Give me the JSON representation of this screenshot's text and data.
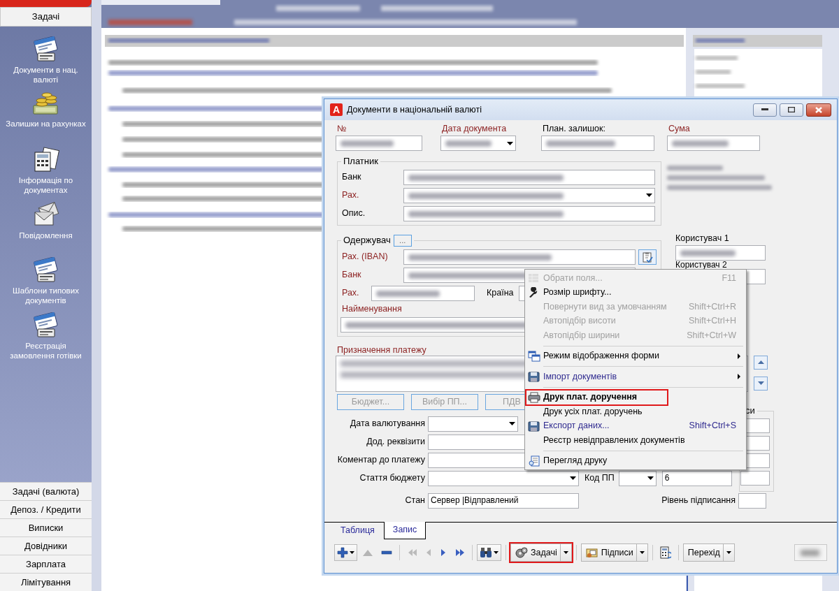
{
  "sidebar": {
    "header": "Задачі",
    "items": [
      "Документи в нац. валюті",
      "Залишки на рахунках",
      "Інформація по документах",
      "Повідомлення",
      "Шаблони типових документів",
      "Реєстрація замовлення готівки"
    ],
    "sections": [
      "Задачі (валюта)",
      "Депоз. / Кредити",
      "Виписки",
      "Довідники",
      "Зарплата",
      "Лімітування"
    ]
  },
  "dialog": {
    "app_logo": "A",
    "title": "Документи в національній валюті",
    "header_fields": [
      {
        "label": "№",
        "required": true,
        "kind": "text",
        "redacted": true
      },
      {
        "label": "Дата документа",
        "required": true,
        "kind": "dropdown",
        "redacted": true
      },
      {
        "label": "План. залишок:",
        "required": false,
        "kind": "text",
        "redacted": true
      },
      {
        "label": "Сума",
        "required": true,
        "kind": "text",
        "redacted": true
      }
    ],
    "payer": {
      "legend": "Платник",
      "rows": [
        {
          "label": "Банк",
          "required": false,
          "kind": "text",
          "redacted": true
        },
        {
          "label": "Рах.",
          "required": true,
          "kind": "dropdown",
          "redacted": true
        },
        {
          "label": "Опис.",
          "required": false,
          "kind": "text",
          "redacted": true
        }
      ]
    },
    "recipient": {
      "legend": "Одержувач",
      "picker_button": "...",
      "rows": [
        {
          "label": "Рах. (IBAN)",
          "required": true,
          "redacted": true
        },
        {
          "label": "Банк",
          "required": true,
          "redacted": true
        },
        {
          "label": "Рах.",
          "required": true,
          "redacted": true
        },
        {
          "label": "Країна",
          "required": false,
          "redacted": false
        },
        {
          "label": "Найменування",
          "required": true,
          "redacted": true
        }
      ]
    },
    "users": [
      {
        "label": "Користувач 1",
        "redacted": true
      },
      {
        "label": "Користувач 2"
      }
    ],
    "purpose": {
      "label": "Призначення платежу",
      "required": true,
      "redacted": true
    },
    "purpose_buttons": [
      {
        "label": "Бюджет...",
        "disabled": true
      },
      {
        "label": "Вибір ПП...",
        "disabled": true
      },
      {
        "label": "ПДВ",
        "disabled": true
      }
    ],
    "details": [
      {
        "label": "Дата валютування",
        "kind": "dropdown"
      },
      {
        "label": "Дод. реквізити",
        "kind": "text"
      },
      {
        "label": "Коментар до платежу",
        "kind": "text"
      },
      {
        "label": "Стаття бюджету",
        "kind": "dropdown"
      }
    ],
    "budget_code": {
      "label": "Код ПП",
      "value": "6"
    },
    "signatures_legend": "си",
    "status": {
      "label": "Стан",
      "value": "Сервер |Відправлений"
    },
    "sign_level": {
      "label": "Рівень підписання"
    },
    "tabs": [
      {
        "label": "Таблиця",
        "selected": false
      },
      {
        "label": "Запис",
        "selected": true
      }
    ],
    "toolbar": [
      {
        "kind": "add",
        "caret": true
      },
      {
        "kind": "up",
        "caret": false,
        "disabled": true
      },
      {
        "kind": "remove",
        "caret": false
      },
      {
        "kind": "separator"
      },
      {
        "kind": "first",
        "caret": false,
        "disabled": true
      },
      {
        "kind": "prev",
        "caret": false,
        "disabled": true
      },
      {
        "kind": "next",
        "caret": false,
        "disabled": false
      },
      {
        "kind": "last",
        "caret": false,
        "disabled": false
      },
      {
        "kind": "separator"
      },
      {
        "kind": "find",
        "caret": true
      },
      {
        "kind": "separator"
      },
      {
        "kind": "tasks",
        "label": "Задачі",
        "caret": true,
        "highlighted": true
      },
      {
        "kind": "separator"
      },
      {
        "kind": "signatures",
        "label": "Підписи",
        "caret": true,
        "highlighted": false
      },
      {
        "kind": "separator"
      },
      {
        "kind": "calc",
        "caret": false
      },
      {
        "kind": "separator"
      },
      {
        "kind": "goto",
        "label": "Перехід",
        "caret": true,
        "highlighted": false
      },
      {
        "kind": "field",
        "redacted": true
      }
    ]
  },
  "context_menu": [
    {
      "kind": "command",
      "label": "Обрати поля...",
      "shortcut": "F11",
      "disabled": true,
      "accent": false,
      "submenu": false,
      "highlighted": false,
      "default": false
    },
    {
      "kind": "command",
      "label": "Розмір шрифту...",
      "disabled": false,
      "accent": false,
      "submenu": false,
      "highlighted": false,
      "default": false
    },
    {
      "kind": "command",
      "label": "Повернути вид за умовчанням",
      "shortcut": "Shift+Ctrl+R",
      "disabled": true,
      "accent": false,
      "submenu": false,
      "highlighted": false,
      "default": false
    },
    {
      "kind": "command",
      "label": "Автопідбір висоти",
      "shortcut": "Shift+Ctrl+H",
      "disabled": true,
      "accent": false,
      "submenu": false,
      "highlighted": false,
      "default": false
    },
    {
      "kind": "command",
      "label": "Автопідбір ширини",
      "shortcut": "Shift+Ctrl+W",
      "disabled": true,
      "accent": false,
      "submenu": false,
      "highlighted": false,
      "default": false
    },
    {
      "kind": "separator"
    },
    {
      "kind": "command",
      "label": "Режим відображення форми",
      "disabled": false,
      "accent": false,
      "submenu": true,
      "highlighted": false,
      "default": false
    },
    {
      "kind": "separator"
    },
    {
      "kind": "command",
      "label": "Імпорт документів",
      "disabled": false,
      "accent": true,
      "submenu": true,
      "highlighted": false,
      "default": false
    },
    {
      "kind": "separator"
    },
    {
      "kind": "command",
      "label": "Друк плат. доручення",
      "disabled": false,
      "accent": false,
      "submenu": false,
      "highlighted": true,
      "default": true
    },
    {
      "kind": "command",
      "label": "Друк усіх плат. доручень",
      "disabled": false,
      "accent": false,
      "submenu": false,
      "highlighted": false,
      "default": false
    },
    {
      "kind": "command",
      "label": "Експорт даних...",
      "shortcut": "Shift+Ctrl+S",
      "disabled": false,
      "accent": true,
      "submenu": false,
      "highlighted": false,
      "default": false
    },
    {
      "kind": "command",
      "label": "Реєстр невідправлених документів",
      "disabled": false,
      "accent": false,
      "submenu": false,
      "highlighted": false,
      "default": false
    },
    {
      "kind": "separator"
    },
    {
      "kind": "command",
      "label": "Перегляд друку",
      "disabled": false,
      "accent": false,
      "submenu": false,
      "highlighted": false,
      "default": false
    }
  ]
}
